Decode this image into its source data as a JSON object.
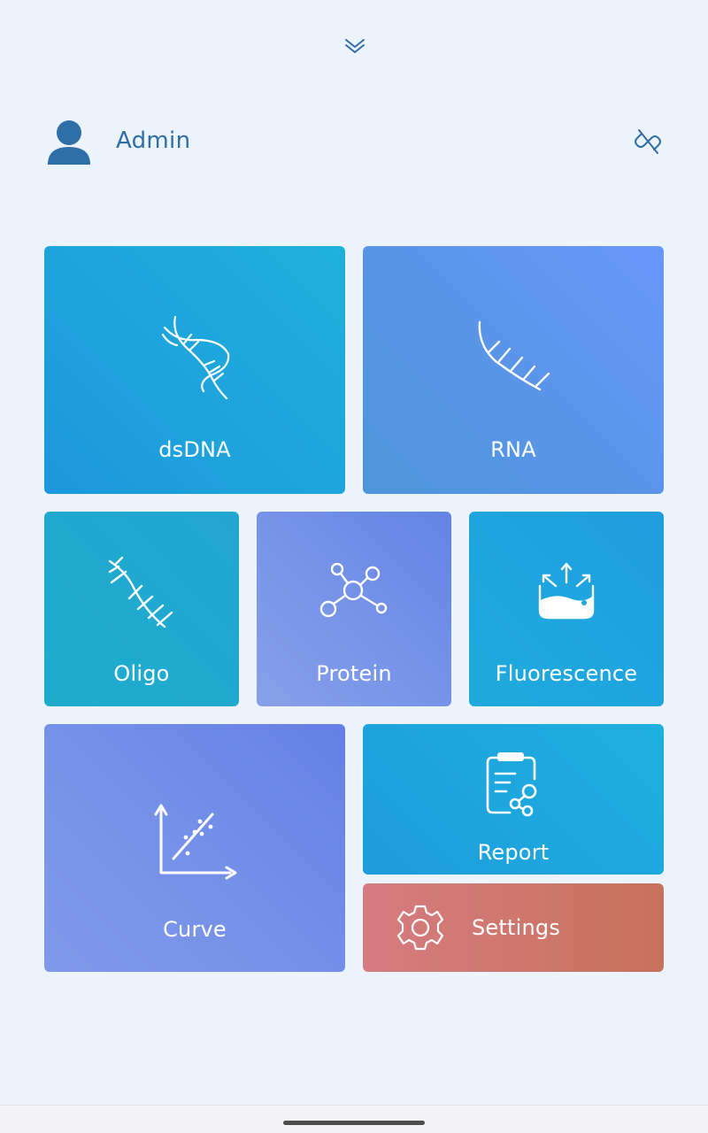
{
  "header": {
    "user_name": "Admin",
    "icons": {
      "expand": "chevron-double-down-icon",
      "user": "user-icon",
      "disconnect": "link-off-icon"
    }
  },
  "tiles": {
    "dsdna": {
      "label": "dsDNA",
      "icon": "dna-double-helix-icon"
    },
    "rna": {
      "label": "RNA",
      "icon": "rna-strand-icon"
    },
    "oligo": {
      "label": "Oligo",
      "icon": "oligo-strand-icon"
    },
    "protein": {
      "label": "Protein",
      "icon": "molecule-network-icon"
    },
    "fluorescence": {
      "label": "Fluorescence",
      "icon": "cuvette-emission-icon"
    },
    "curve": {
      "label": "Curve",
      "icon": "scatter-regression-icon"
    },
    "report": {
      "label": "Report",
      "icon": "clipboard-share-icon"
    },
    "settings": {
      "label": "Settings",
      "icon": "gear-icon"
    }
  },
  "colors": {
    "background": "#ecf3fa",
    "accent_text": "#2f6ea5",
    "user_icon": "#2e6fa8",
    "settings_tile": "#d07a72"
  }
}
